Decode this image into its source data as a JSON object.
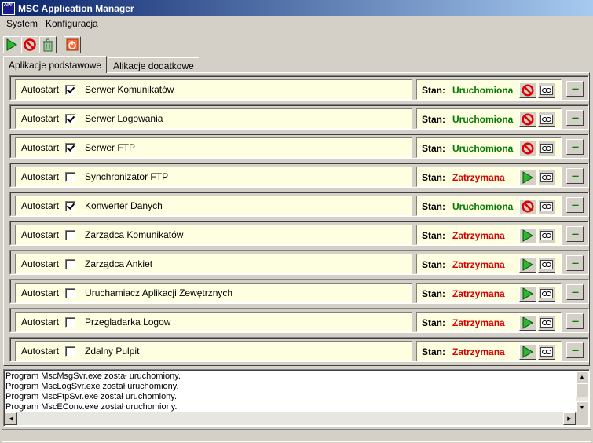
{
  "window": {
    "title": "MSC Application Manager",
    "icon_text": "APP"
  },
  "menu": [
    "System",
    "Konfiguracja"
  ],
  "toolbar": {
    "icons": [
      "start-all-icon",
      "stop-all-icon",
      "recycle-icon",
      "shutdown-icon"
    ]
  },
  "tabs": [
    {
      "label": "Aplikacje podstawowe",
      "active": true
    },
    {
      "label": "Alikacje dodatkowe",
      "active": false
    }
  ],
  "labels": {
    "autostart": "Autostart",
    "stan": "Stan:",
    "more": "---"
  },
  "apps": [
    {
      "name": "Serwer Komunikatów",
      "autostart": true,
      "state": "Uruchomiona"
    },
    {
      "name": "Serwer Logowania",
      "autostart": true,
      "state": "Uruchomiona"
    },
    {
      "name": "Serwer FTP",
      "autostart": true,
      "state": "Uruchomiona"
    },
    {
      "name": "Synchronizator FTP",
      "autostart": false,
      "state": "Zatrzymana"
    },
    {
      "name": "Konwerter Danych",
      "autostart": true,
      "state": "Uruchomiona"
    },
    {
      "name": "Zarządca Komunikatów",
      "autostart": false,
      "state": "Zatrzymana"
    },
    {
      "name": "Zarządca Ankiet",
      "autostart": false,
      "state": "Zatrzymana"
    },
    {
      "name": "Uruchamiacz Aplikacji Zewętrznych",
      "autostart": false,
      "state": "Zatrzymana"
    },
    {
      "name": "Przegladarka Logow",
      "autostart": false,
      "state": "Zatrzymana"
    },
    {
      "name": "Zdalny Pulpit",
      "autostart": false,
      "state": "Zatrzymana"
    }
  ],
  "states": {
    "running": "Uruchomiona",
    "stopped": "Zatrzymana"
  },
  "colors": {
    "running": "#007a00",
    "stopped": "#d80000",
    "panel_bg": "#fefee0"
  },
  "log": [
    "Program MscMsgSvr.exe został uruchomiony.",
    "Program MscLogSvr.exe został uruchomiony.",
    "Program MscFtpSvr.exe został uruchomiony.",
    "Program MscEConv.exe został uruchomiony."
  ]
}
